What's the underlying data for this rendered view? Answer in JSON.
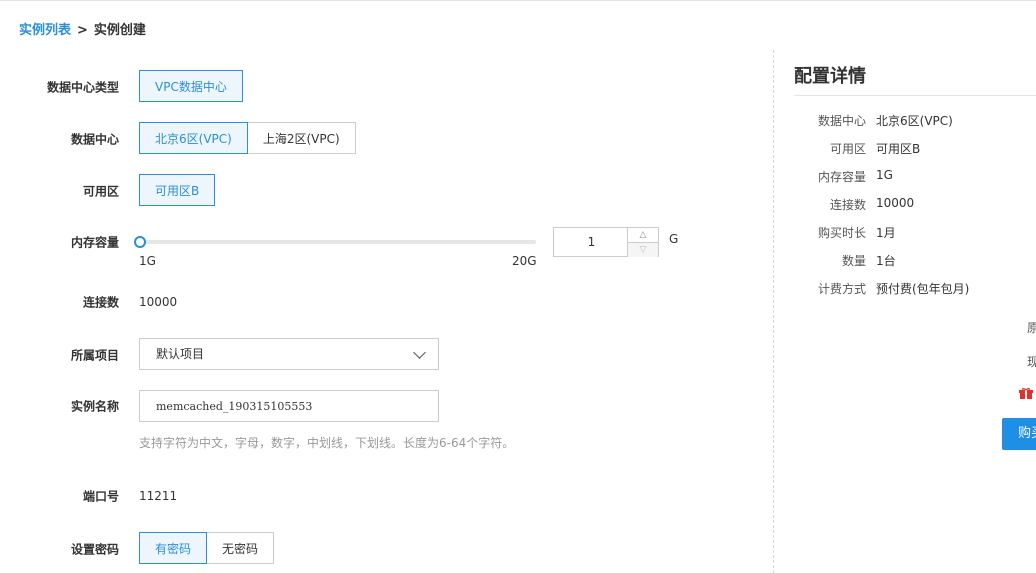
{
  "breadcrumb": {
    "parent": "实例列表",
    "separator": ">",
    "current": "实例创建"
  },
  "form": {
    "dc_type": {
      "label": "数据中心类型",
      "options": [
        "VPC数据中心"
      ]
    },
    "dc": {
      "label": "数据中心",
      "options": [
        "北京6区(VPC)",
        "上海2区(VPC)"
      ]
    },
    "zone": {
      "label": "可用区",
      "options": [
        "可用区B"
      ]
    },
    "memory": {
      "label": "内存容量",
      "min_label": "1G",
      "max_label": "20G",
      "value": "1",
      "unit": "G",
      "min": 1,
      "max": 20,
      "current": 1
    },
    "connections": {
      "label": "连接数",
      "value": "10000"
    },
    "project": {
      "label": "所属项目",
      "value": "默认项目"
    },
    "name": {
      "label": "实例名称",
      "value": "memcached_190315105553",
      "hint": "支持字符为中文，字母，数字，中划线，下划线。长度为6-64个字符。"
    },
    "port": {
      "label": "端口号",
      "value": "11211"
    },
    "password": {
      "label": "设置密码",
      "options": [
        "有密码",
        "无密码"
      ]
    }
  },
  "details": {
    "title": "配置详情",
    "items": [
      {
        "k": "数据中心",
        "v": "北京6区(VPC)"
      },
      {
        "k": "可用区",
        "v": "可用区B"
      },
      {
        "k": "内存容量",
        "v": "1G"
      },
      {
        "k": "连接数",
        "v": "10000"
      },
      {
        "k": "购买时长",
        "v": "1月"
      },
      {
        "k": "数量",
        "v": "1台"
      },
      {
        "k": "计费方式",
        "v": "预付费(包年包月)"
      }
    ],
    "price_labels": [
      "原",
      "现"
    ],
    "buy_label": "购买"
  },
  "colors": {
    "accent": "#2b8fd6",
    "button": "#1f8ee5",
    "gift": "#e0322b"
  }
}
